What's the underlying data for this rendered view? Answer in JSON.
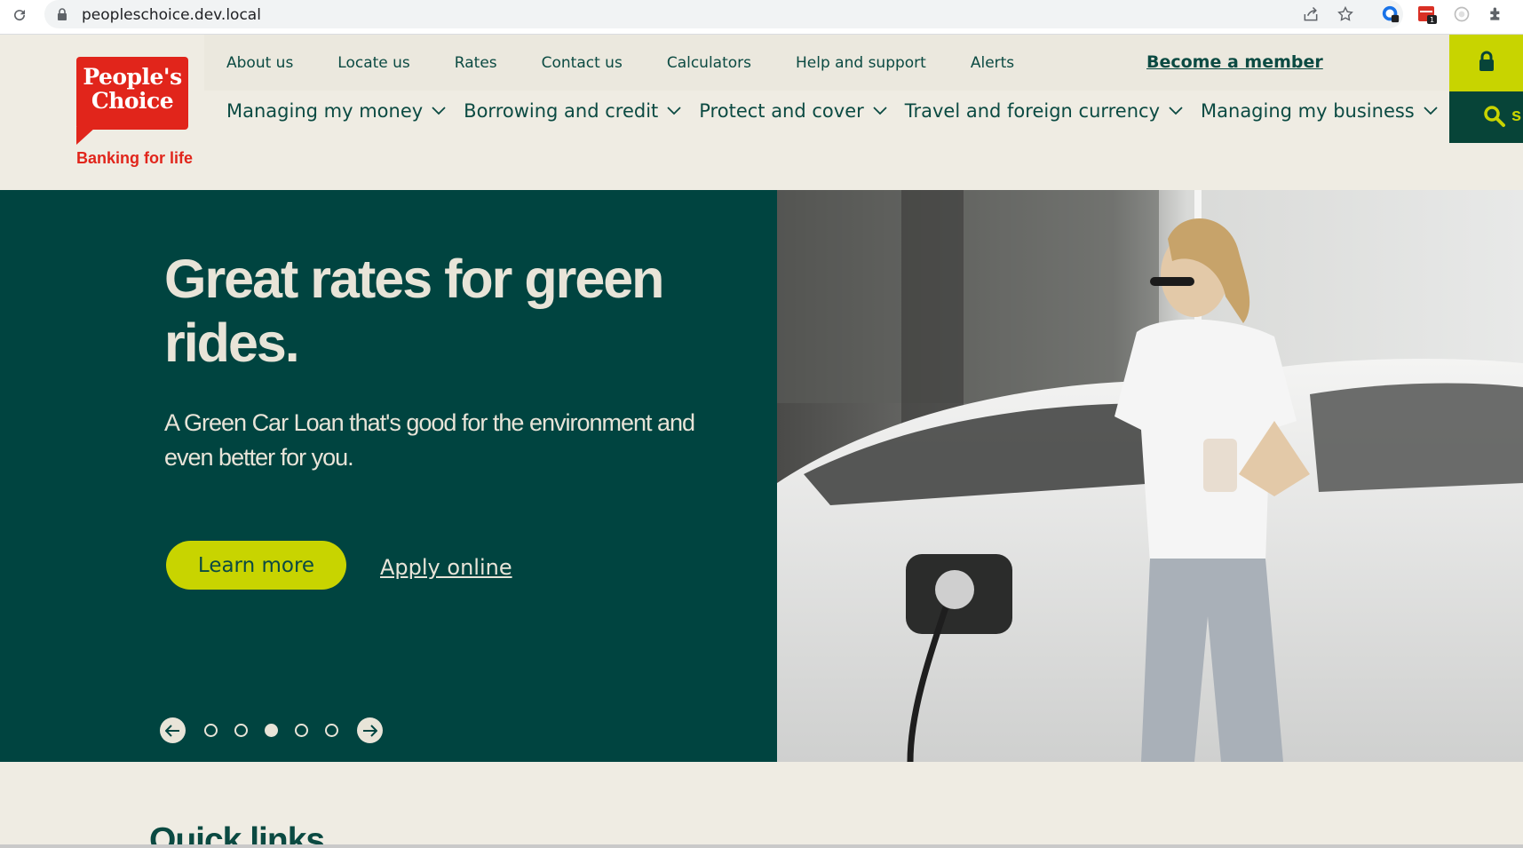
{
  "browser": {
    "url": "peopleschoice.dev.local",
    "extension_badge": "1"
  },
  "brand": {
    "logo_line1": "People's",
    "logo_line2": "Choice",
    "tagline": "Banking for life"
  },
  "top_nav": [
    "About us",
    "Locate us",
    "Rates",
    "Contact us",
    "Calculators",
    "Help and support",
    "Alerts"
  ],
  "become_member": "Become a member",
  "main_nav": [
    "Managing my money",
    "Borrowing and credit",
    "Protect and cover",
    "Travel and foreign currency",
    "Managing my business"
  ],
  "search": {
    "label_fragment": "s"
  },
  "hero": {
    "title": "Great rates for green rides.",
    "subtitle": "A Green Car Loan that's good for the environment and even better for you.",
    "primary_button": "Learn more",
    "secondary_link": "Apply online",
    "slides_total": 5,
    "active_slide": 3
  },
  "quick_links": {
    "heading": "Quick links"
  },
  "icons": {
    "reload": "reload-icon",
    "lock": "padlock-icon",
    "share": "share-icon",
    "bookmark": "star-icon",
    "search": "search-icon",
    "chevron": "chevron-down-icon",
    "prev": "arrow-left-icon",
    "next": "arrow-right-icon"
  },
  "colors": {
    "brand_red": "#e1251b",
    "dark_green": "#004440",
    "lime": "#c8d400",
    "cream": "#efece3"
  }
}
